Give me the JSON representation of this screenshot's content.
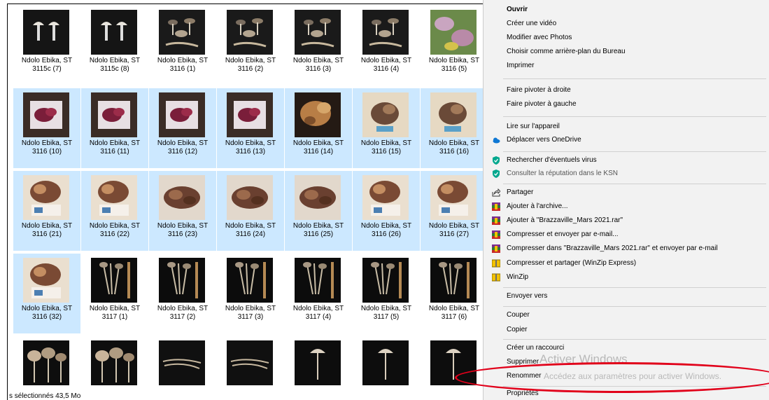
{
  "thumbnails": [
    {
      "line1": "Ndolo Ebika, ST",
      "line2": "3115c (7)",
      "kind": "mush2",
      "selected": false
    },
    {
      "line1": "Ndolo Ebika, ST",
      "line2": "3115c (8)",
      "kind": "mush2",
      "selected": false
    },
    {
      "line1": "Ndolo Ebika, ST",
      "line2": "3116 (1)",
      "kind": "mushdark",
      "selected": false
    },
    {
      "line1": "Ndolo Ebika, ST",
      "line2": "3116 (2)",
      "kind": "mushdark",
      "selected": false
    },
    {
      "line1": "Ndolo Ebika, ST",
      "line2": "3116 (3)",
      "kind": "mushdark",
      "selected": false
    },
    {
      "line1": "Ndolo Ebika, ST",
      "line2": "3116 (4)",
      "kind": "mushdark",
      "selected": false
    },
    {
      "line1": "Ndolo Ebika, ST",
      "line2": "3116 (5)",
      "kind": "leaves",
      "selected": false
    },
    {
      "line1": "Ndolo Ebika, ST",
      "line2": "3116 (10)",
      "kind": "paper",
      "selected": true
    },
    {
      "line1": "Ndolo Ebika, ST",
      "line2": "3116 (11)",
      "kind": "paper",
      "selected": true
    },
    {
      "line1": "Ndolo Ebika, ST",
      "line2": "3116 (12)",
      "kind": "paper",
      "selected": true
    },
    {
      "line1": "Ndolo Ebika, ST",
      "line2": "3116 (13)",
      "kind": "paper",
      "selected": true
    },
    {
      "line1": "Ndolo Ebika, ST",
      "line2": "3116 (14)",
      "kind": "brownheap",
      "selected": true
    },
    {
      "line1": "Ndolo Ebika, ST",
      "line2": "3116 (15)",
      "kind": "beige",
      "selected": true
    },
    {
      "line1": "Ndolo Ebika, ST",
      "line2": "3116 (16)",
      "kind": "beige",
      "selected": true
    },
    {
      "line1": "Ndolo Ebika, ST",
      "line2": "3116 (21)",
      "kind": "scale",
      "selected": true
    },
    {
      "line1": "Ndolo Ebika, ST",
      "line2": "3116 (22)",
      "kind": "scale",
      "selected": true
    },
    {
      "line1": "Ndolo Ebika, ST",
      "line2": "3116 (23)",
      "kind": "cloth",
      "selected": true
    },
    {
      "line1": "Ndolo Ebika, ST",
      "line2": "3116 (24)",
      "kind": "cloth",
      "selected": true
    },
    {
      "line1": "Ndolo Ebika, ST",
      "line2": "3116 (25)",
      "kind": "cloth",
      "selected": true
    },
    {
      "line1": "Ndolo Ebika, ST",
      "line2": "3116 (26)",
      "kind": "scale",
      "selected": true
    },
    {
      "line1": "Ndolo Ebika, ST",
      "line2": "3116 (27)",
      "kind": "scale",
      "selected": true
    },
    {
      "line1": "Ndolo Ebika, ST",
      "line2": "3116 (32)",
      "kind": "scale",
      "selected": true
    },
    {
      "line1": "Ndolo Ebika, ST",
      "line2": "3117 (1)",
      "kind": "stems",
      "selected": false
    },
    {
      "line1": "Ndolo Ebika, ST",
      "line2": "3117 (2)",
      "kind": "stems",
      "selected": false
    },
    {
      "line1": "Ndolo Ebika, ST",
      "line2": "3117 (3)",
      "kind": "stems",
      "selected": false
    },
    {
      "line1": "Ndolo Ebika, ST",
      "line2": "3117 (4)",
      "kind": "stems",
      "selected": false
    },
    {
      "line1": "Ndolo Ebika, ST",
      "line2": "3117 (5)",
      "kind": "stems",
      "selected": false
    },
    {
      "line1": "Ndolo Ebika, ST",
      "line2": "3117 (6)",
      "kind": "stems",
      "selected": false
    },
    {
      "line1": "",
      "line2": "",
      "kind": "caps",
      "selected": false
    },
    {
      "line1": "",
      "line2": "",
      "kind": "caps",
      "selected": false
    },
    {
      "line1": "",
      "line2": "",
      "kind": "roots",
      "selected": false
    },
    {
      "line1": "",
      "line2": "",
      "kind": "roots",
      "selected": false
    },
    {
      "line1": "",
      "line2": "",
      "kind": "single",
      "selected": false
    },
    {
      "line1": "",
      "line2": "",
      "kind": "single",
      "selected": false
    },
    {
      "line1": "",
      "line2": "",
      "kind": "single",
      "selected": false
    }
  ],
  "status_text": "s sélectionnés  43,5 Mo",
  "menu": {
    "open": "Ouvrir",
    "create_video": "Créer une vidéo",
    "edit_photos": "Modifier avec Photos",
    "set_background": "Choisir comme arrière-plan du Bureau",
    "print": "Imprimer",
    "rotate_right": "Faire pivoter à droite",
    "rotate_left": "Faire pivoter à gauche",
    "play_to_device": "Lire sur l'appareil",
    "move_onedrive": "Déplacer vers OneDrive",
    "scan_virus": "Rechercher d'éventuels virus",
    "ksn_reputation": "Consulter la réputation dans le KSN",
    "share": "Partager",
    "add_archive": "Ajouter à l'archive...",
    "add_named_rar": "Ajouter à \"Brazzaville_Mars 2021.rar\"",
    "compress_email": "Compresser et envoyer par e-mail...",
    "compress_named_email": "Compresser dans \"Brazzaville_Mars 2021.rar\" et envoyer par e-mail",
    "compress_share_winzip": "Compresser et partager (WinZip Express)",
    "winzip": "WinZip",
    "send_to": "Envoyer vers",
    "cut": "Couper",
    "copy": "Copier",
    "create_shortcut": "Créer un raccourci",
    "delete": "Supprimer",
    "rename": "Renommer",
    "properties": "Propriétés"
  },
  "watermark": {
    "line1": "Activer Windows",
    "line2": "Accédez aux paramètres pour activer Windows."
  },
  "colors": {
    "selection": "#cce8ff",
    "menu_bg": "#f2f2f2",
    "highlight_ring": "#e1001a",
    "onedrive": "#0f78d4",
    "kaspersky": "#00a88e",
    "winzip_yellow": "#f2c200"
  }
}
